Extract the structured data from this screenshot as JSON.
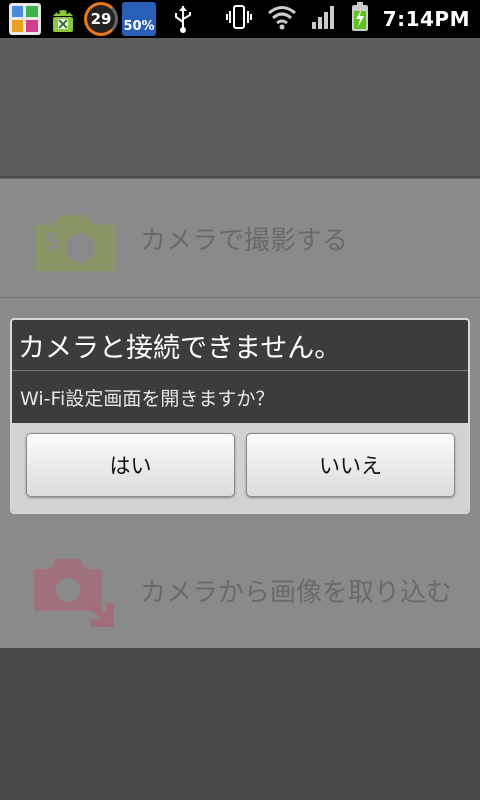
{
  "status_bar": {
    "icons": [
      "widgets-icon",
      "android-download-icon",
      "battery-circle-icon",
      "weather-icon",
      "usb-icon",
      "vibrate-icon",
      "wifi-icon",
      "signal-icon",
      "battery-charging-icon"
    ],
    "badge_circle": "29",
    "badge_weather": "50%",
    "time": "7:14PM"
  },
  "app": {
    "menu_items": [
      {
        "label": "カメラで撮影する",
        "icon": "camera-capture-icon",
        "color": "#8aa05a"
      },
      {
        "label": "カメラから画像を取り込む",
        "icon": "camera-import-icon",
        "color": "#b06a80"
      }
    ]
  },
  "dialog": {
    "title": "カメラと接続できません。",
    "message": "Wi-Fi設定画面を開きますか？",
    "yes_label": "はい",
    "no_label": "いいえ"
  }
}
